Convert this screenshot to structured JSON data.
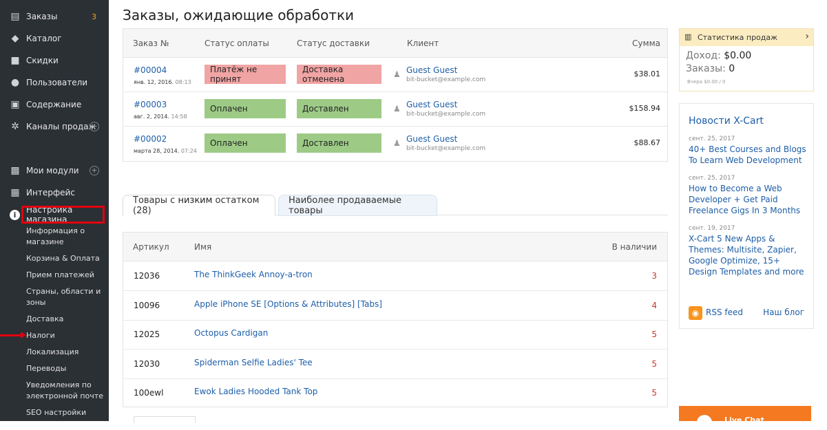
{
  "sidebar": {
    "items": [
      {
        "label": "Заказы",
        "icon": "orders-icon",
        "badge": "3"
      },
      {
        "label": "Каталог",
        "icon": "tag-icon"
      },
      {
        "label": "Скидки",
        "icon": "gift-icon"
      },
      {
        "label": "Пользователи",
        "icon": "users-icon"
      },
      {
        "label": "Содержание",
        "icon": "content-icon"
      },
      {
        "label": "Каналы продаж",
        "icon": "network-icon",
        "plus": "+"
      },
      {
        "label": "Мои модули",
        "icon": "puzzle-icon",
        "plus": "+"
      },
      {
        "label": "Интерфейс",
        "icon": "image-icon"
      },
      {
        "label": "Настройка магазина",
        "icon": "info-icon"
      }
    ],
    "subitems": [
      "Информация о магазине",
      "Корзина & Оплата",
      "Прием платежей",
      "Страны, области и зоны",
      "Доставка",
      "Налоги",
      "Локализация",
      "Переводы",
      "Уведомления по электронной почте",
      "SEO настройки"
    ]
  },
  "main": {
    "title": "Заказы, ожидающие обработки",
    "orders_table": {
      "headers": [
        "Заказ №",
        "Статус оплаты",
        "Статус доставки",
        "Клиент",
        "Сумма"
      ],
      "rows": [
        {
          "num": "#00004",
          "date": "янв. 12, 2016.",
          "time": "08:13",
          "payment": "Платёж не принят",
          "shipping": "Доставка отменена",
          "client": "Guest Guest",
          "email": "bit-bucket@example.com",
          "sum": "$38.01",
          "status_color": "red"
        },
        {
          "num": "#00003",
          "date": "авг. 2, 2014.",
          "time": "14:58",
          "payment": "Оплачен",
          "shipping": "Доставлен",
          "client": "Guest Guest",
          "email": "bit-bucket@example.com",
          "sum": "$158.94",
          "status_color": "green"
        },
        {
          "num": "#00002",
          "date": "марта 28, 2014.",
          "time": "07:24",
          "payment": "Оплачен",
          "shipping": "Доставлен",
          "client": "Guest Guest",
          "email": "bit-bucket@example.com",
          "sum": "$88.67",
          "status_color": "green"
        }
      ]
    },
    "tabs": [
      {
        "label_prefix": "Товары с ",
        "label_bold": "низким",
        "label_suffix": " остатком (28)"
      },
      {
        "label": "Наиболее продаваемые товары"
      }
    ],
    "stock_table": {
      "headers": [
        "Артикул",
        "Имя",
        "В наличии"
      ],
      "rows": [
        {
          "sku": "12036",
          "name": "The ThinkGeek Annoy-a-tron",
          "qty": "3"
        },
        {
          "sku": "10096",
          "name": "Apple iPhone SE [Options & Attributes] [Tabs]",
          "qty": "4"
        },
        {
          "sku": "12025",
          "name": "Octopus Cardigan",
          "qty": "5"
        },
        {
          "sku": "12030",
          "name": "Spiderman Selfie Ladies' Tee",
          "qty": "5"
        },
        {
          "sku": "100ewl",
          "name": "Ewok Ladies Hooded Tank Top",
          "qty": "5"
        }
      ]
    }
  },
  "stats": {
    "title": "Статистика продаж",
    "income_label": "Доход:",
    "income_value": "$0.00",
    "orders_label": "Заказы:",
    "orders_value": "0",
    "tiny": "Вчера $0.00 / 0"
  },
  "news": {
    "title": "Новости X-Cart",
    "items": [
      {
        "date": "сент. 25, 2017",
        "title": "40+ Best Courses and Blogs To Learn Web Development"
      },
      {
        "date": "сент. 25, 2017",
        "title": "How to Become a Web Developer + Get Paid Freelance Gigs In 3 Months"
      },
      {
        "date": "сент. 19, 2017",
        "title": "X-Cart 5 New Apps & Themes: Multisite, Zapier, Google Optimize, 15+ Design Templates and more"
      }
    ],
    "rss_label": "RSS feed",
    "blog_label": "Наш блог"
  },
  "livechat": {
    "label": "Live Chat"
  },
  "colors": {
    "sidebar_bg": "#2b3035",
    "link": "#1d5ea8",
    "status_red": "#f1a4a4",
    "status_green": "#9dcb86",
    "highlight": "#e3000f"
  }
}
